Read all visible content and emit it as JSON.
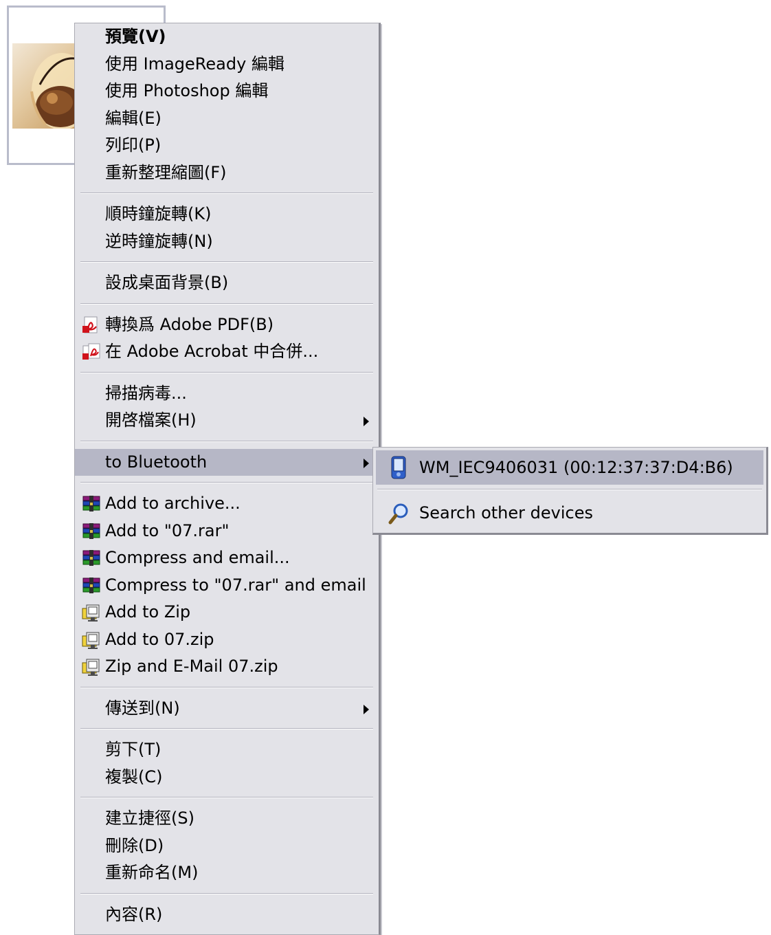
{
  "menu": {
    "groups": [
      [
        {
          "label": "預覽(V)",
          "bold": true
        },
        {
          "label": "使用 ImageReady 編輯"
        },
        {
          "label": "使用 Photoshop 編輯"
        },
        {
          "label": "編輯(E)"
        },
        {
          "label": "列印(P)"
        },
        {
          "label": "重新整理縮圖(F)"
        }
      ],
      [
        {
          "label": "順時鐘旋轉(K)"
        },
        {
          "label": "逆時鐘旋轉(N)"
        }
      ],
      [
        {
          "label": "設成桌面背景(B)"
        }
      ],
      [
        {
          "label": "轉換爲 Adobe PDF(B)",
          "icon": "pdf-convert-icon"
        },
        {
          "label": "在 Adobe Acrobat 中合併...",
          "icon": "acrobat-combine-icon"
        }
      ],
      [
        {
          "label": "掃描病毒..."
        },
        {
          "label": "開啓檔案(H)",
          "submenu": true
        }
      ],
      [
        {
          "label": "to Bluetooth",
          "submenu": true,
          "highlighted": true
        }
      ],
      [
        {
          "label": "Add to archive...",
          "icon": "winrar-icon"
        },
        {
          "label": "Add to \"07.rar\"",
          "icon": "winrar-icon"
        },
        {
          "label": "Compress and email...",
          "icon": "winrar-icon"
        },
        {
          "label": "Compress to \"07.rar\" and email",
          "icon": "winrar-icon"
        },
        {
          "label": "Add to Zip",
          "icon": "winzip-icon"
        },
        {
          "label": "Add to 07.zip",
          "icon": "winzip-icon"
        },
        {
          "label": "Zip and E-Mail 07.zip",
          "icon": "winzip-icon"
        }
      ],
      [
        {
          "label": "傳送到(N)",
          "submenu": true
        }
      ],
      [
        {
          "label": "剪下(T)"
        },
        {
          "label": "複製(C)"
        }
      ],
      [
        {
          "label": "建立捷徑(S)"
        },
        {
          "label": "刪除(D)"
        },
        {
          "label": "重新命名(M)"
        }
      ],
      [
        {
          "label": "內容(R)"
        }
      ]
    ]
  },
  "bluetooth_submenu": {
    "items": [
      {
        "label": "WM_IEC9406031 (00:12:37:37:D4:B6)",
        "icon": "pda-device-icon",
        "highlighted": true
      },
      {
        "label": "Search other devices",
        "icon": "search-magnifier-icon"
      }
    ]
  },
  "colors": {
    "menu_bg": "#e3e3e8",
    "highlight": "#b6b7c6",
    "thumb_border": "#b9bccb"
  }
}
